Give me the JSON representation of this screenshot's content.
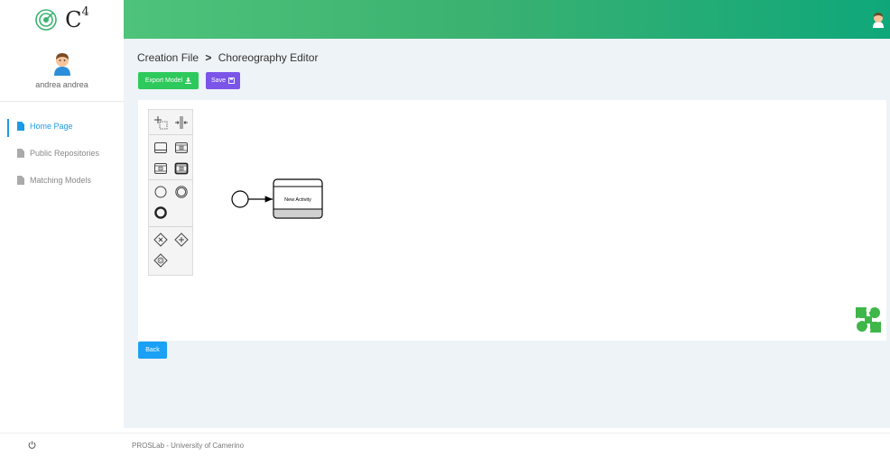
{
  "brand": {
    "logo_text": "C",
    "logo_sup": "4"
  },
  "user": {
    "name": "andrea andrea"
  },
  "sidebar": {
    "items": [
      {
        "label": "Home Page",
        "icon": "document-icon",
        "active": true
      },
      {
        "label": "Public Repositories",
        "icon": "document-icon",
        "active": false
      },
      {
        "label": "Matching Models",
        "icon": "document-icon",
        "active": false
      }
    ]
  },
  "breadcrumb": {
    "parent": "Creation File",
    "separator": ">",
    "current": "Choreography Editor"
  },
  "toolbar": {
    "export_label": "Export Model",
    "export_icon": "download-icon",
    "save_label": "Save",
    "save_icon": "floppy-icon"
  },
  "diagram": {
    "task_label": "New Activity"
  },
  "actions": {
    "back_label": "Back"
  },
  "footer": {
    "text": "PROSLab - University of Camerino"
  },
  "colors": {
    "header_start": "#4ec37a",
    "header_end": "#0fa77a",
    "active_nav": "#1b9be7",
    "export_button": "#2ec95c",
    "save_button": "#7b55e8",
    "back_button": "#1aa1f5",
    "puzzle": "#3eb649"
  }
}
